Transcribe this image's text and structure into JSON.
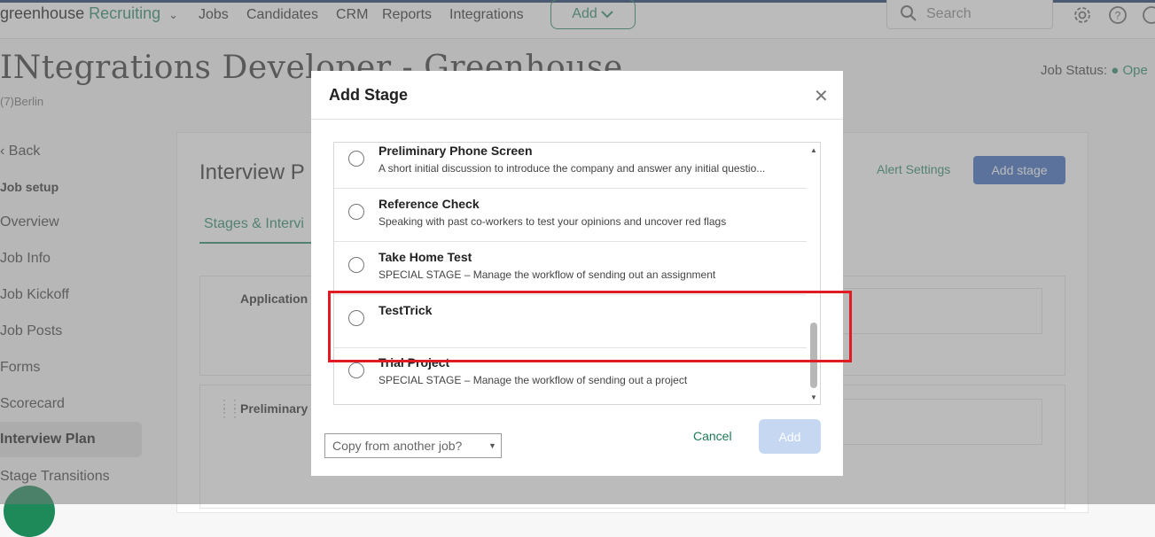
{
  "topnav": {
    "brand_main": "greenhouse",
    "brand_sub": "Recruiting",
    "items": [
      "Jobs",
      "Candidates",
      "CRM",
      "Reports",
      "Integrations"
    ],
    "add_label": "Add",
    "search_placeholder": "Search"
  },
  "job": {
    "title": "INtegrations Developer - Greenhouse",
    "subtitle": "(7)Berlin",
    "status_label": "Job Status:",
    "status_value": "Ope"
  },
  "sidebar": {
    "back_label": "Back",
    "section_label": "Job setup",
    "items": [
      "Overview",
      "Job Info",
      "Job Kickoff",
      "Job Posts",
      "Forms",
      "Scorecard",
      "Interview Plan",
      "Stage Transitions"
    ],
    "active_index": 6
  },
  "main": {
    "title": "Interview P",
    "alert_settings": "Alert Settings",
    "add_stage": "Add stage",
    "tab_label": "Stages & Intervi",
    "stage_labels": [
      "Application",
      "Preliminary"
    ]
  },
  "modal": {
    "title": "Add Stage",
    "options": [
      {
        "name": "Preliminary Phone Screen",
        "desc": "A short initial discussion to introduce the company and answer any initial questio..."
      },
      {
        "name": "Reference Check",
        "desc": "Speaking with past co-workers to test your opinions and uncover red flags"
      },
      {
        "name": "Take Home Test",
        "desc": "SPECIAL STAGE – Manage the workflow of sending out an assignment"
      },
      {
        "name": "TestTrick",
        "desc": ""
      },
      {
        "name": "Trial Project",
        "desc": "SPECIAL STAGE – Manage the workflow of sending out a project"
      }
    ],
    "copy_placeholder": "Copy from another job?",
    "cancel_label": "Cancel",
    "add_label": "Add"
  }
}
